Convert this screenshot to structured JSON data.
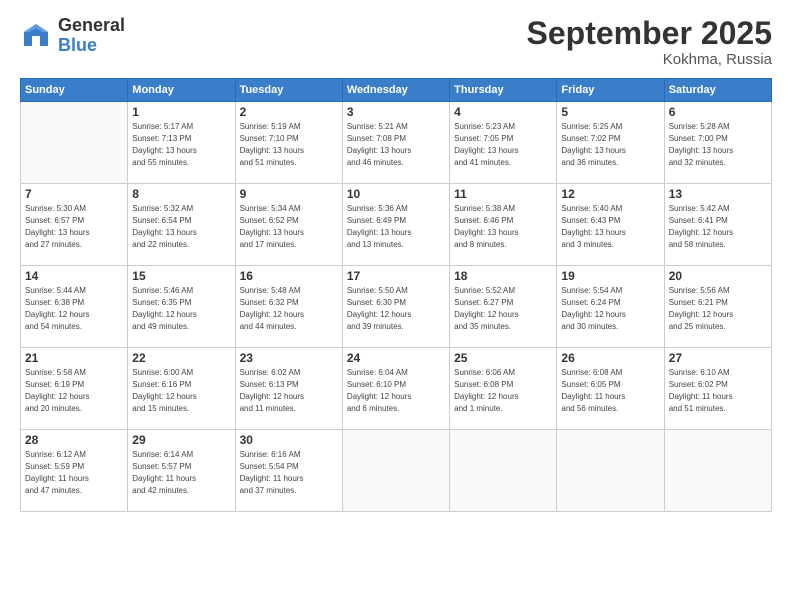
{
  "header": {
    "logo_general": "General",
    "logo_blue": "Blue",
    "month_title": "September 2025",
    "location": "Kokhma, Russia"
  },
  "weekdays": [
    "Sunday",
    "Monday",
    "Tuesday",
    "Wednesday",
    "Thursday",
    "Friday",
    "Saturday"
  ],
  "weeks": [
    [
      {
        "day": "",
        "info": ""
      },
      {
        "day": "1",
        "info": "Sunrise: 5:17 AM\nSunset: 7:13 PM\nDaylight: 13 hours\nand 55 minutes."
      },
      {
        "day": "2",
        "info": "Sunrise: 5:19 AM\nSunset: 7:10 PM\nDaylight: 13 hours\nand 51 minutes."
      },
      {
        "day": "3",
        "info": "Sunrise: 5:21 AM\nSunset: 7:08 PM\nDaylight: 13 hours\nand 46 minutes."
      },
      {
        "day": "4",
        "info": "Sunrise: 5:23 AM\nSunset: 7:05 PM\nDaylight: 13 hours\nand 41 minutes."
      },
      {
        "day": "5",
        "info": "Sunrise: 5:25 AM\nSunset: 7:02 PM\nDaylight: 13 hours\nand 36 minutes."
      },
      {
        "day": "6",
        "info": "Sunrise: 5:28 AM\nSunset: 7:00 PM\nDaylight: 13 hours\nand 32 minutes."
      }
    ],
    [
      {
        "day": "7",
        "info": "Sunrise: 5:30 AM\nSunset: 6:57 PM\nDaylight: 13 hours\nand 27 minutes."
      },
      {
        "day": "8",
        "info": "Sunrise: 5:32 AM\nSunset: 6:54 PM\nDaylight: 13 hours\nand 22 minutes."
      },
      {
        "day": "9",
        "info": "Sunrise: 5:34 AM\nSunset: 6:52 PM\nDaylight: 13 hours\nand 17 minutes."
      },
      {
        "day": "10",
        "info": "Sunrise: 5:36 AM\nSunset: 6:49 PM\nDaylight: 13 hours\nand 13 minutes."
      },
      {
        "day": "11",
        "info": "Sunrise: 5:38 AM\nSunset: 6:46 PM\nDaylight: 13 hours\nand 8 minutes."
      },
      {
        "day": "12",
        "info": "Sunrise: 5:40 AM\nSunset: 6:43 PM\nDaylight: 13 hours\nand 3 minutes."
      },
      {
        "day": "13",
        "info": "Sunrise: 5:42 AM\nSunset: 6:41 PM\nDaylight: 12 hours\nand 58 minutes."
      }
    ],
    [
      {
        "day": "14",
        "info": "Sunrise: 5:44 AM\nSunset: 6:38 PM\nDaylight: 12 hours\nand 54 minutes."
      },
      {
        "day": "15",
        "info": "Sunrise: 5:46 AM\nSunset: 6:35 PM\nDaylight: 12 hours\nand 49 minutes."
      },
      {
        "day": "16",
        "info": "Sunrise: 5:48 AM\nSunset: 6:32 PM\nDaylight: 12 hours\nand 44 minutes."
      },
      {
        "day": "17",
        "info": "Sunrise: 5:50 AM\nSunset: 6:30 PM\nDaylight: 12 hours\nand 39 minutes."
      },
      {
        "day": "18",
        "info": "Sunrise: 5:52 AM\nSunset: 6:27 PM\nDaylight: 12 hours\nand 35 minutes."
      },
      {
        "day": "19",
        "info": "Sunrise: 5:54 AM\nSunset: 6:24 PM\nDaylight: 12 hours\nand 30 minutes."
      },
      {
        "day": "20",
        "info": "Sunrise: 5:56 AM\nSunset: 6:21 PM\nDaylight: 12 hours\nand 25 minutes."
      }
    ],
    [
      {
        "day": "21",
        "info": "Sunrise: 5:58 AM\nSunset: 6:19 PM\nDaylight: 12 hours\nand 20 minutes."
      },
      {
        "day": "22",
        "info": "Sunrise: 6:00 AM\nSunset: 6:16 PM\nDaylight: 12 hours\nand 15 minutes."
      },
      {
        "day": "23",
        "info": "Sunrise: 6:02 AM\nSunset: 6:13 PM\nDaylight: 12 hours\nand 11 minutes."
      },
      {
        "day": "24",
        "info": "Sunrise: 6:04 AM\nSunset: 6:10 PM\nDaylight: 12 hours\nand 6 minutes."
      },
      {
        "day": "25",
        "info": "Sunrise: 6:06 AM\nSunset: 6:08 PM\nDaylight: 12 hours\nand 1 minute."
      },
      {
        "day": "26",
        "info": "Sunrise: 6:08 AM\nSunset: 6:05 PM\nDaylight: 11 hours\nand 56 minutes."
      },
      {
        "day": "27",
        "info": "Sunrise: 6:10 AM\nSunset: 6:02 PM\nDaylight: 11 hours\nand 51 minutes."
      }
    ],
    [
      {
        "day": "28",
        "info": "Sunrise: 6:12 AM\nSunset: 5:59 PM\nDaylight: 11 hours\nand 47 minutes."
      },
      {
        "day": "29",
        "info": "Sunrise: 6:14 AM\nSunset: 5:57 PM\nDaylight: 11 hours\nand 42 minutes."
      },
      {
        "day": "30",
        "info": "Sunrise: 6:16 AM\nSunset: 5:54 PM\nDaylight: 11 hours\nand 37 minutes."
      },
      {
        "day": "",
        "info": ""
      },
      {
        "day": "",
        "info": ""
      },
      {
        "day": "",
        "info": ""
      },
      {
        "day": "",
        "info": ""
      }
    ]
  ]
}
